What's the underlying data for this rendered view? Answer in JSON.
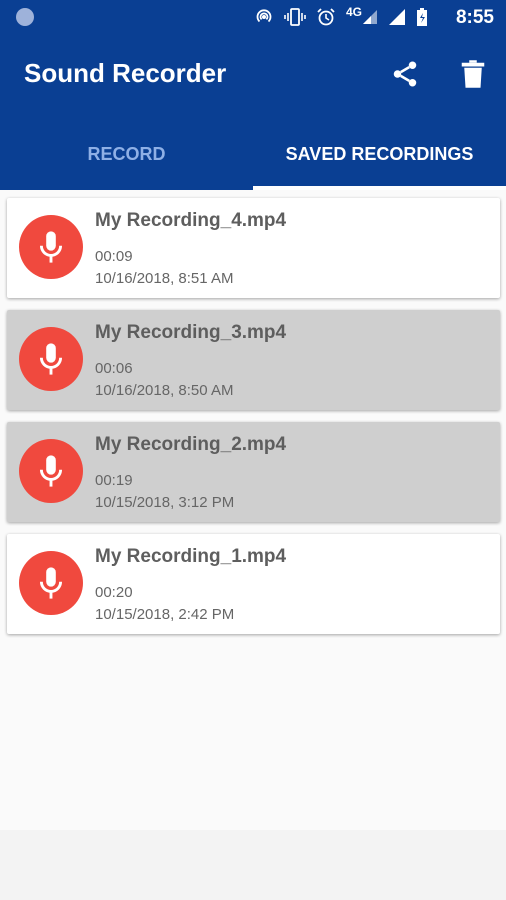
{
  "status_bar": {
    "network": "4G",
    "time": "8:55"
  },
  "app_bar": {
    "title": "Sound Recorder"
  },
  "tabs": [
    {
      "label": "RECORD",
      "selected": false
    },
    {
      "label": "SAVED RECORDINGS",
      "selected": true
    }
  ],
  "recordings": [
    {
      "name": "My Recording_4.mp4",
      "duration": "00:09",
      "date": "10/16/2018, 8:51 AM",
      "highlighted": false
    },
    {
      "name": "My Recording_3.mp4",
      "duration": "00:06",
      "date": "10/16/2018, 8:50 AM",
      "highlighted": true
    },
    {
      "name": "My Recording_2.mp4",
      "duration": "00:19",
      "date": "10/15/2018, 3:12 PM",
      "highlighted": true
    },
    {
      "name": "My Recording_1.mp4",
      "duration": "00:20",
      "date": "10/15/2018, 2:42 PM",
      "highlighted": false
    }
  ],
  "colors": {
    "primary": "#0a3f93",
    "mic_accent": "#f0493e",
    "highlight_row": "#cfcfcf"
  }
}
